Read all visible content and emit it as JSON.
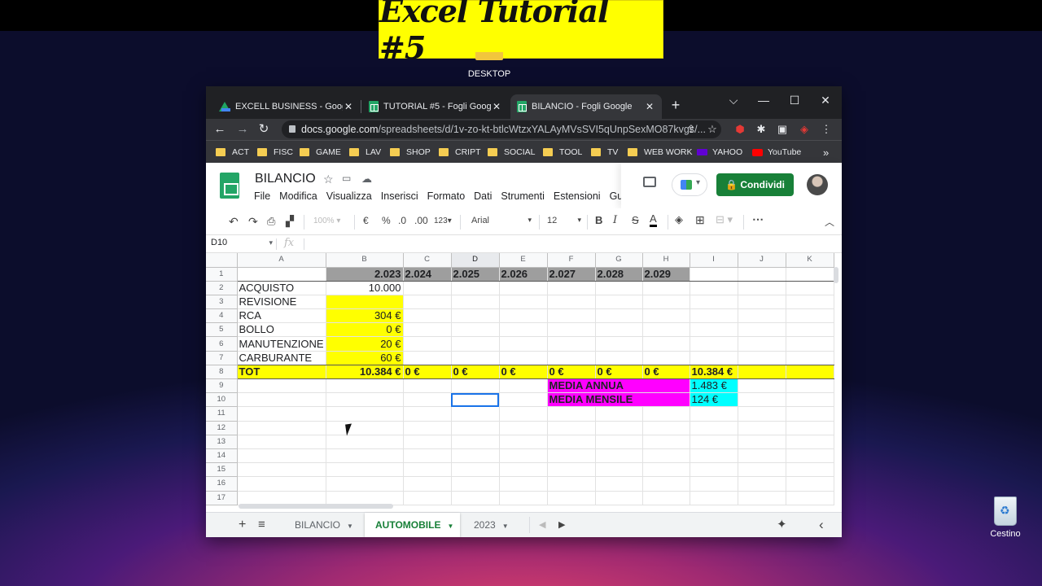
{
  "overlay": {
    "title": "Excel Tutorial #5"
  },
  "desktop": {
    "folder_label": "DESKTOP",
    "recycle_bin": "Cestino"
  },
  "browser": {
    "tabs": [
      {
        "label": "EXCELL BUSINESS - Google D",
        "icon": "drive-icon"
      },
      {
        "label": "TUTORIAL #5 - Fogli Google",
        "icon": "sheets-icon"
      },
      {
        "label": "BILANCIO - Fogli Google",
        "icon": "sheets-icon"
      }
    ],
    "url_host": "docs.google.com",
    "url_path": "/spreadsheets/d/1v-zo-kt-btlcWtzxYALAyMVsSVI5qUnpSexMO87kvgs/...",
    "bookmarks": [
      "ACT",
      "FISC",
      "GAME",
      "LAV",
      "SHOP",
      "CRIPT",
      "SOCIAL",
      "TOOL",
      "TV",
      "WEB WORK",
      "YAHOO",
      "YouTube"
    ],
    "bookmarks_more": "»"
  },
  "doc": {
    "title": "BILANCIO",
    "menu": [
      "File",
      "Modifica",
      "Visualizza",
      "Inserisci",
      "Formato",
      "Dati",
      "Strumenti",
      "Estensioni",
      "Gui"
    ],
    "share_label": "Condividi",
    "lock_icon": "🔒"
  },
  "toolbar": {
    "zoom": "100%",
    "currency": "€",
    "percent": "%",
    "dec_less": ".0",
    "dec_more": ".00",
    "format_more": "123",
    "font": "Arial",
    "font_size": "12",
    "bold": "B",
    "italic": "I",
    "strike": "S",
    "text_color": "A"
  },
  "formula_bar": {
    "name_box": "D10",
    "fx": "fx"
  },
  "grid": {
    "columns": [
      "A",
      "B",
      "C",
      "D",
      "E",
      "F",
      "G",
      "H",
      "I",
      "J",
      "K"
    ],
    "rows": [
      [
        "",
        "2.023",
        "2.024",
        "2.025",
        "2.026",
        "2.027",
        "2.028",
        "2.029",
        "",
        "",
        ""
      ],
      [
        "ACQUISTO",
        "10.000",
        "",
        "",
        "",
        "",
        "",
        "",
        "",
        "",
        ""
      ],
      [
        "REVISIONE",
        "",
        "",
        "",
        "",
        "",
        "",
        "",
        "",
        "",
        ""
      ],
      [
        "RCA",
        "304 €",
        "",
        "",
        "",
        "",
        "",
        "",
        "",
        "",
        ""
      ],
      [
        "BOLLO",
        "0 €",
        "",
        "",
        "",
        "",
        "",
        "",
        "",
        "",
        ""
      ],
      [
        "MANUTENZIONE",
        "20 €",
        "",
        "",
        "",
        "",
        "",
        "",
        "",
        "",
        ""
      ],
      [
        "CARBURANTE",
        "60 €",
        "",
        "",
        "",
        "",
        "",
        "",
        "",
        "",
        ""
      ],
      [
        "TOT",
        "10.384 €",
        "0 €",
        "0 €",
        "0 €",
        "0 €",
        "0 €",
        "0 €",
        "10.384 €",
        "",
        ""
      ],
      [
        "",
        "",
        "",
        "",
        "",
        "MEDIA ANNUA",
        "",
        "",
        "1.483 €",
        "",
        ""
      ],
      [
        "",
        "",
        "",
        "",
        "",
        "MEDIA MENSILE",
        "",
        "",
        "124 €",
        "",
        ""
      ],
      [
        "",
        "",
        "",
        "",
        "",
        "",
        "",
        "",
        "",
        "",
        ""
      ],
      [
        "",
        "",
        "",
        "",
        "",
        "",
        "",
        "",
        "",
        "",
        ""
      ],
      [
        "",
        "",
        "",
        "",
        "",
        "",
        "",
        "",
        "",
        "",
        ""
      ],
      [
        "",
        "",
        "",
        "",
        "",
        "",
        "",
        "",
        "",
        "",
        ""
      ],
      [
        "",
        "",
        "",
        "",
        "",
        "",
        "",
        "",
        "",
        "",
        ""
      ],
      [
        "",
        "",
        "",
        "",
        "",
        "",
        "",
        "",
        "",
        "",
        ""
      ],
      [
        "",
        "",
        "",
        "",
        "",
        "",
        "",
        "",
        "",
        "",
        ""
      ]
    ],
    "selected_cell": "D10"
  },
  "sheet_tabs": {
    "add": "+",
    "list": "≡",
    "tabs": [
      "BILANCIO",
      "AUTOMOBILE",
      "2023"
    ],
    "active": "AUTOMOBILE",
    "explore": "✦",
    "collapse": "‹"
  },
  "colors": {
    "header_fill": "#9e9e9e",
    "input_fill": "#ffff00",
    "total_fill": "#ffff00",
    "media_fill": "#ff00ff",
    "result_fill": "#00ffff",
    "share_button": "#188038"
  }
}
